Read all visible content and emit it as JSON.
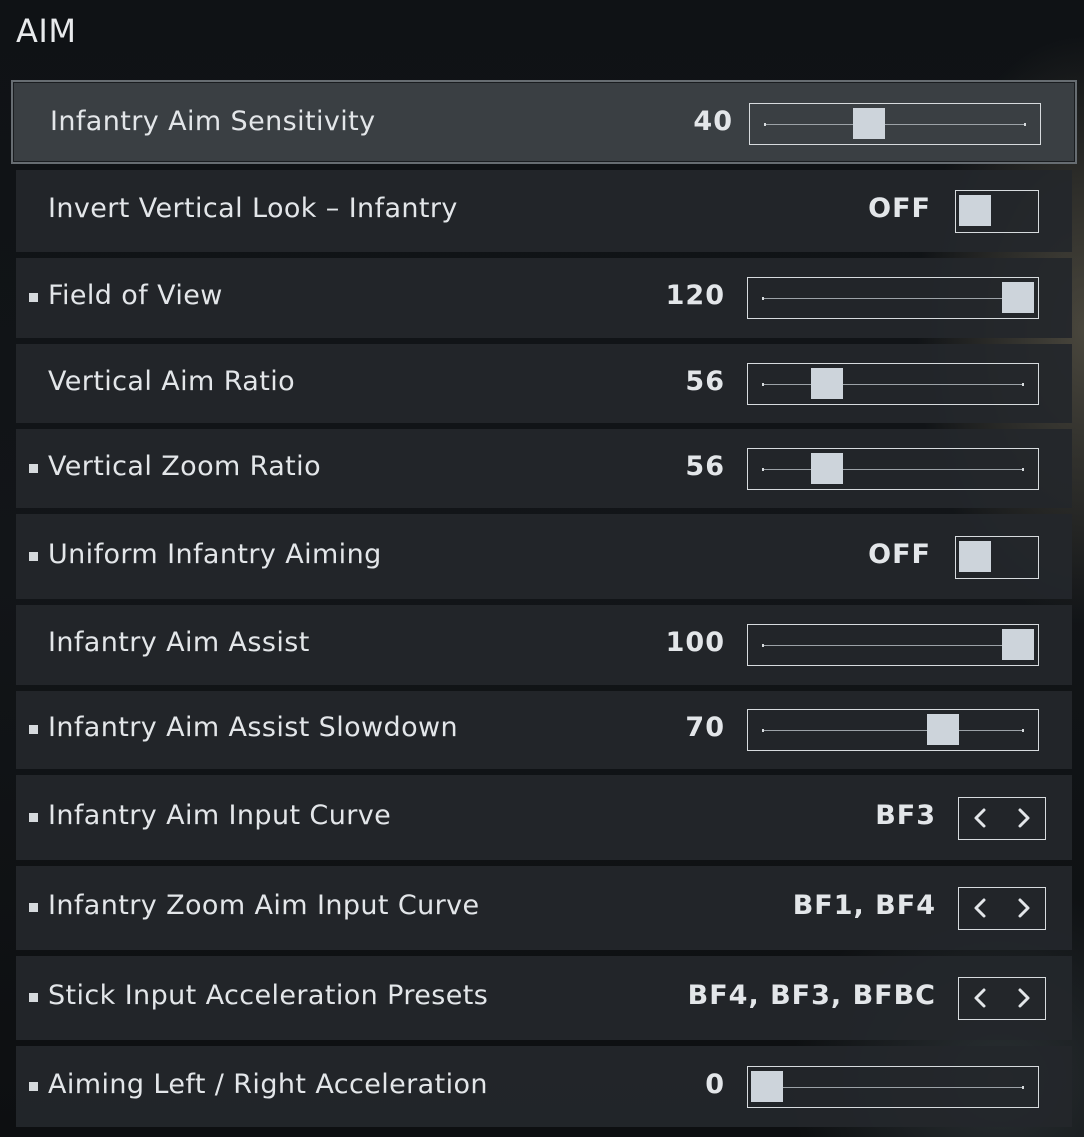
{
  "section_title": "AIM",
  "settings": [
    {
      "label": "Infantry Aim Sensitivity",
      "type": "slider",
      "value": "40",
      "fraction": 0.4,
      "bullet": false,
      "selected": true
    },
    {
      "label": "Invert Vertical Look – Infantry",
      "type": "toggle",
      "value": "OFF",
      "bullet": false
    },
    {
      "label": "Field of View",
      "type": "slider",
      "value": "120",
      "fraction": 1.0,
      "bullet": true
    },
    {
      "label": "Vertical Aim Ratio",
      "type": "slider",
      "value": "56",
      "fraction": 0.24,
      "bullet": false
    },
    {
      "label": "Vertical Zoom Ratio",
      "type": "slider",
      "value": "56",
      "fraction": 0.24,
      "bullet": true
    },
    {
      "label": "Uniform Infantry Aiming",
      "type": "toggle",
      "value": "OFF",
      "bullet": true
    },
    {
      "label": "Infantry Aim Assist",
      "type": "slider",
      "value": "100",
      "fraction": 1.0,
      "bullet": false
    },
    {
      "label": "Infantry Aim Assist Slowdown",
      "type": "slider",
      "value": "70",
      "fraction": 0.7,
      "bullet": true
    },
    {
      "label": "Infantry Aim Input Curve",
      "type": "stepper",
      "value": "BF3",
      "bullet": true
    },
    {
      "label": "Infantry Zoom Aim Input Curve",
      "type": "stepper",
      "value": "BF1, BF4",
      "bullet": true
    },
    {
      "label": "Stick Input Acceleration Presets",
      "type": "stepper",
      "value": "BF4, BF3, BFBC",
      "bullet": true
    },
    {
      "label": "Aiming Left / Right Acceleration",
      "type": "slider",
      "value": "0",
      "fraction": 0.0,
      "bullet": true
    }
  ],
  "icons": {
    "prev": "chevron-left-icon",
    "next": "chevron-right-icon"
  },
  "colors": {
    "thumb": "#cdd4db",
    "row_bg": "#23272b",
    "selected_row_bg": "#3a3f43"
  }
}
